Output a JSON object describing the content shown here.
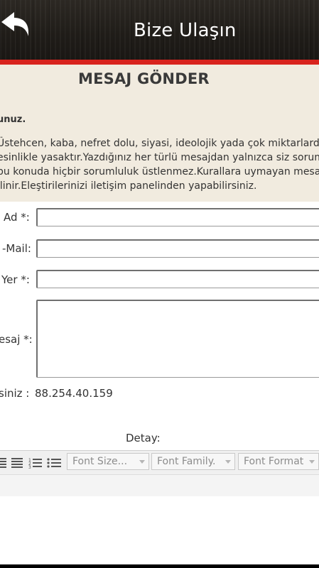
{
  "header": {
    "title": "Bize Ulaşın",
    "back_icon": "back-arrow-icon"
  },
  "info": {
    "title": "MESAJ GÖNDER",
    "notice_bold": "unuz.",
    "lines": [
      "Üstehcen, kaba, nefret dolu, siyasi, ideolojik yada çok miktarlarda",
      "esinlikle yasaktır.Yazdığınız her türlü mesajdan yalnızca siz sorum",
      "bu konuda hiçbir sorumluluk üstlenmez.Kurallara uymayan mesa",
      "ilinir.Eleştirilerinizi iletişim panelinden yapabilirsiniz."
    ]
  },
  "form": {
    "name_label": "Ad *:",
    "email_label": "-Mail:",
    "place_label": "Yer *:",
    "message_label": "esaj *:",
    "ip_label": "siniz :",
    "ip_value": "88.254.40.159",
    "detail_label": "Detay:"
  },
  "editor": {
    "font_size": "Font Size...",
    "font_family": "Font Family.",
    "font_format": "Font Format"
  }
}
